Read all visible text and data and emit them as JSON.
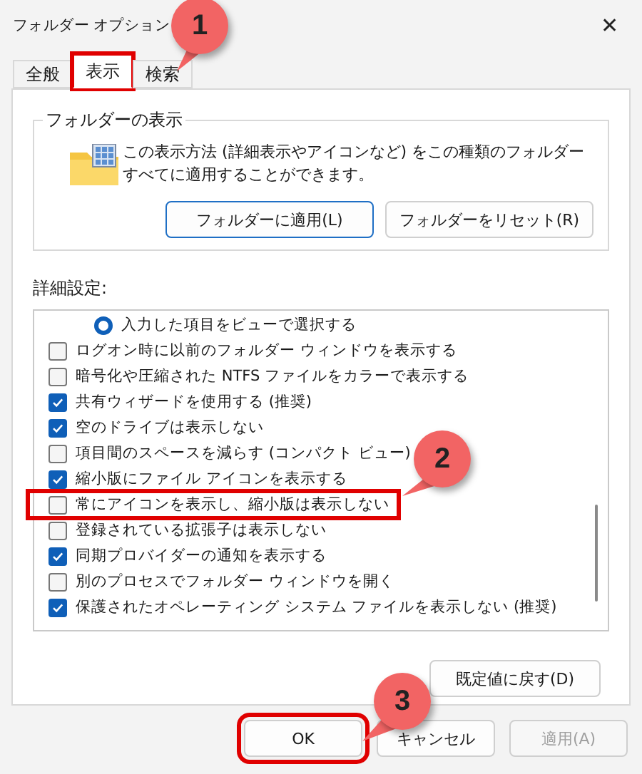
{
  "window": {
    "title": "フォルダー オプション",
    "close": "✕"
  },
  "tabs": [
    {
      "label": "全般",
      "selected": false,
      "highlighted": false
    },
    {
      "label": "表示",
      "selected": true,
      "highlighted": true
    },
    {
      "label": "検索",
      "selected": false,
      "highlighted": false
    }
  ],
  "folder_views": {
    "title": "フォルダーの表示",
    "description": "この表示方法 (詳細表示やアイコンなど) をこの種類のフォルダーすべてに適用することができます。",
    "buttons": [
      {
        "label": "フォルダーに適用(L)",
        "focused": true
      },
      {
        "label": "フォルダーをリセット(R)",
        "focused": false
      }
    ]
  },
  "advanced": {
    "title": "詳細設定:",
    "items": [
      {
        "kind": "radio",
        "label": "入力した項目をビューで選択する",
        "checked": true,
        "highlighted": false
      },
      {
        "kind": "checkbox",
        "label": "ログオン時に以前のフォルダー ウィンドウを表示する",
        "checked": false,
        "highlighted": false
      },
      {
        "kind": "checkbox",
        "label": "暗号化や圧縮された NTFS ファイルをカラーで表示する",
        "checked": false,
        "highlighted": false
      },
      {
        "kind": "checkbox",
        "label": "共有ウィザードを使用する (推奨)",
        "checked": true,
        "highlighted": false
      },
      {
        "kind": "checkbox",
        "label": "空のドライブは表示しない",
        "checked": true,
        "highlighted": false
      },
      {
        "kind": "checkbox",
        "label": "項目間のスペースを減らす (コンパクト ビュー)",
        "checked": false,
        "highlighted": false
      },
      {
        "kind": "checkbox",
        "label": "縮小版にファイル アイコンを表示する",
        "checked": true,
        "highlighted": false
      },
      {
        "kind": "checkbox",
        "label": "常にアイコンを表示し、縮小版は表示しない",
        "checked": false,
        "highlighted": true
      },
      {
        "kind": "checkbox",
        "label": "登録されている拡張子は表示しない",
        "checked": false,
        "highlighted": false
      },
      {
        "kind": "checkbox",
        "label": "同期プロバイダーの通知を表示する",
        "checked": true,
        "highlighted": false
      },
      {
        "kind": "checkbox",
        "label": "別のプロセスでフォルダー ウィンドウを開く",
        "checked": false,
        "highlighted": false
      },
      {
        "kind": "checkbox",
        "label": "保護されたオペレーティング システム ファイルを表示しない (推奨)",
        "checked": true,
        "highlighted": false
      }
    ],
    "restore_button": "既定値に戻す(D)"
  },
  "footer_buttons": [
    {
      "label": "OK",
      "disabled": false,
      "highlighted": true
    },
    {
      "label": "キャンセル",
      "disabled": false,
      "highlighted": false
    },
    {
      "label": "適用(A)",
      "disabled": true,
      "highlighted": false
    }
  ],
  "callouts": [
    {
      "label": "1"
    },
    {
      "label": "2"
    },
    {
      "label": "3"
    }
  ]
}
